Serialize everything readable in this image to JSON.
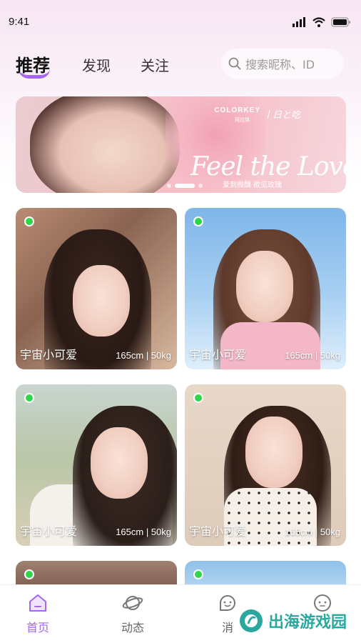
{
  "status_bar": {
    "time": "9:41"
  },
  "header": {
    "tabs": [
      {
        "label": "推荐",
        "active": true
      },
      {
        "label": "发现",
        "active": false
      },
      {
        "label": "关注",
        "active": false
      }
    ],
    "search": {
      "placeholder": "搜索昵称、ID",
      "icon": "search-icon"
    },
    "accent_color": "#a566f0"
  },
  "banner": {
    "brand": "COLORKEY",
    "brand_sub": "珂拉琪",
    "brand_script": "丨日と吃",
    "slogan": "Feel the Love",
    "caption": "爱到微醺  欲见玫瑰",
    "dots": 3,
    "active_dot": 1
  },
  "cards": [
    {
      "name": "宇宙小可爱",
      "stats": "165cm | 50kg",
      "online": true
    },
    {
      "name": "宇宙小可爱",
      "stats": "165cm | 50kg",
      "online": true
    },
    {
      "name": "宇宙小可爱",
      "stats": "165cm | 50kg",
      "online": true
    },
    {
      "name": "宇宙小可爱",
      "stats": "165cm | 50kg",
      "online": true
    },
    {
      "online": true
    },
    {
      "online": true
    }
  ],
  "online_color": "#2fd64a",
  "bottom_nav": [
    {
      "label": "首页",
      "icon": "home-icon",
      "active": true
    },
    {
      "label": "动态",
      "icon": "planet-icon",
      "active": false
    },
    {
      "label": "消",
      "icon": "chat-face-icon",
      "active": false
    },
    {
      "label": "",
      "icon": "profile-face-icon",
      "active": false
    }
  ],
  "watermark": {
    "text": "出海游戏园"
  }
}
